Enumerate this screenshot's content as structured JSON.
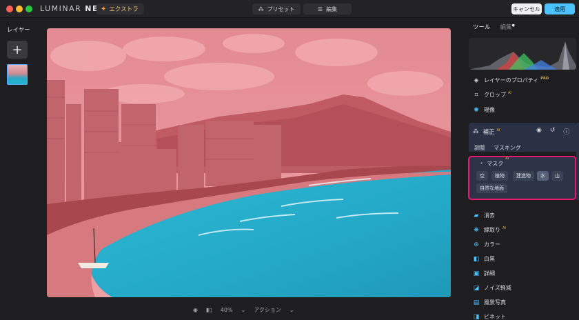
{
  "titlebar": {
    "logo_main": "LUMINAR",
    "logo_accent": "NEO",
    "extras_label": "エクストラ",
    "tabs": [
      {
        "label": "プリセット",
        "icon": "sparkle-icon"
      },
      {
        "label": "編集",
        "icon": "sliders-icon"
      }
    ],
    "cancel_label": "キャンセル",
    "apply_label": "適用"
  },
  "left": {
    "title": "レイヤー",
    "add_symbol": "+"
  },
  "bottom": {
    "zoom": "40%",
    "action": "アクション"
  },
  "right": {
    "tab_tools": "ツール",
    "tab_edit": "編集",
    "tools_top": [
      {
        "label": "レイヤーのプロパティ",
        "icon": "layers-icon",
        "badge": "PRO"
      },
      {
        "label": "クロップ",
        "icon": "crop-icon",
        "badge": "AI"
      },
      {
        "label": "現像",
        "icon": "sun-icon",
        "badge": ""
      }
    ],
    "enhance": {
      "title": "補正",
      "badge": "AI",
      "subtabs": [
        "調整",
        "マスキング"
      ],
      "mask_title": "マスク",
      "mask_badge": "AI",
      "chips": [
        "空",
        "植物",
        "建造物",
        "水",
        "山",
        "自然な地面"
      ],
      "selected_chip": "水"
    },
    "tools_bottom": [
      {
        "label": "消去",
        "icon": "eraser-icon",
        "badge": ""
      },
      {
        "label": "縁取り",
        "icon": "structure-icon",
        "badge": "AI"
      },
      {
        "label": "カラー",
        "icon": "color-icon",
        "badge": ""
      },
      {
        "label": "白黒",
        "icon": "bw-icon",
        "badge": ""
      },
      {
        "label": "詳細",
        "icon": "details-icon",
        "badge": ""
      },
      {
        "label": "ノイズ軽減",
        "icon": "noise-icon",
        "badge": ""
      },
      {
        "label": "風景写真",
        "icon": "landscape-icon",
        "badge": ""
      },
      {
        "label": "ビネット",
        "icon": "vignette-icon",
        "badge": ""
      }
    ]
  },
  "colors": {
    "accent": "#4cc2ff",
    "highlight": "#e6186f",
    "mask_overlay": "#e8707a",
    "water": "#26b4cf"
  }
}
